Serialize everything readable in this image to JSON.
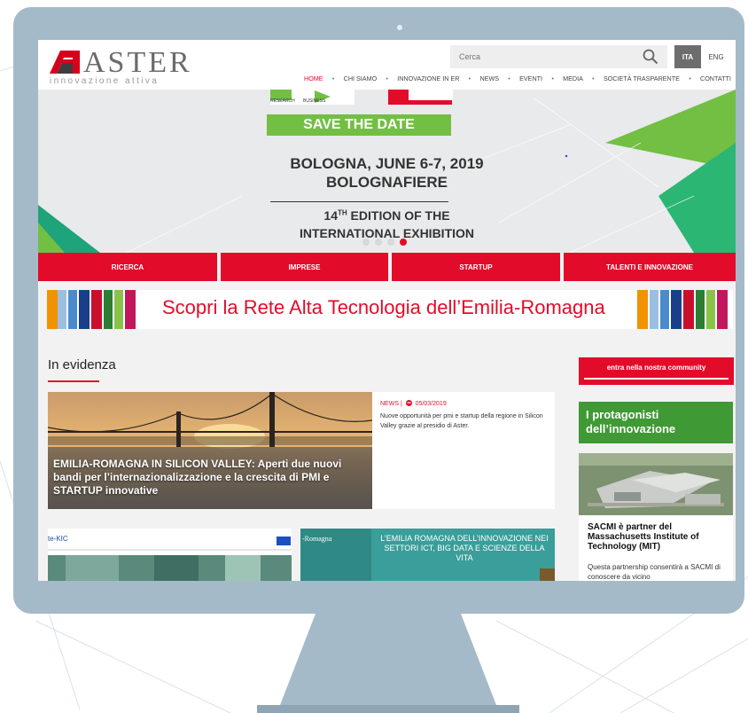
{
  "logo": {
    "name": "ASTER",
    "tagline": "innovazione attiva"
  },
  "search": {
    "placeholder": "Cerca"
  },
  "lang": {
    "active": "ITA",
    "other": "ENG"
  },
  "nav": [
    "HOME",
    "CHI SIAMO",
    "INNOVAZIONE IN ER",
    "NEWS",
    "EVENTI",
    "MEDIA",
    "SOCIETÀ TRASPARENTE",
    "CONTATTI"
  ],
  "nav_separator": "•",
  "hero": {
    "small_left": "RESEARCH",
    "small_right": "BUSINESS",
    "save_date": "SAVE THE DATE",
    "line1": "BOLOGNA, JUNE 6-7, 2019",
    "line2": "BOLOGNAFIERE",
    "line3a": "14",
    "line3sup": "TH",
    "line3b": " EDITION OF THE",
    "line4": "INTERNATIONAL EXHIBITION",
    "slide_count": 4,
    "active_slide": 4
  },
  "tabs": [
    "RICERCA",
    "IMPRESE",
    "STARTUP",
    "TALENTI E INNOVAZIONE"
  ],
  "banner": {
    "text": "Scopri la Rete Alta Tecnologia dell’Emilia-Romagna"
  },
  "section_title": "In evidenza",
  "featured": {
    "title": "EMILIA-ROMAGNA IN SILICON VALLEY: Aperti due nuovi bandi per l’internazionalizzazione e la crescita di PMI e STARTUP innovative",
    "category": "NEWS |",
    "date": "05/03/2019",
    "summary": "Nuove opportunità per pmi e startup della regione in Silicon Valley grazie al presidio di Aster."
  },
  "card2": {
    "label": "te-KIC"
  },
  "card3": {
    "left_label": "-Romagna",
    "text": "L’EMILIA ROMAGNA DELL’INNOVAZIONE NEI SETTORI ICT, BIG DATA E SCIENZE DELLA VITA"
  },
  "sidebar": {
    "community_button": "entra nella nostra community",
    "protagonists_title": "I protagonisti dell’innovazione",
    "story_title": "SACMI è partner del Massachusetts Institute of Technology (MIT)",
    "story_body": "Questa partnership consentirà a SACMI di conoscere da vicino"
  },
  "colors": {
    "brand_red": "#e30b2a",
    "green": "#3f9935",
    "monitor": "#a5bac8"
  }
}
